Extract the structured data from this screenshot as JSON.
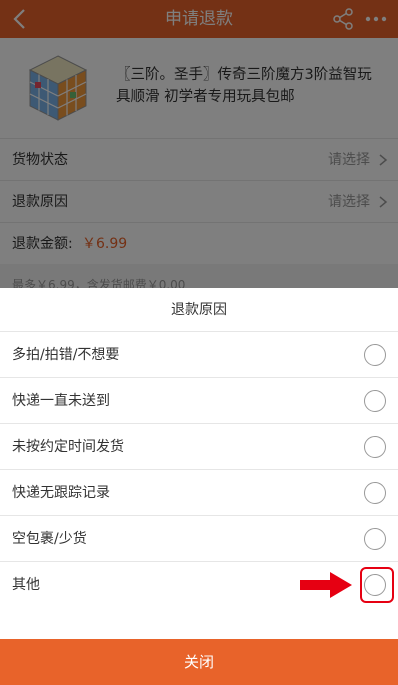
{
  "header": {
    "title": "申请退款",
    "back_icon": "chevron-left-icon",
    "share_icon": "share-icon",
    "more_icon": "more-icon"
  },
  "product": {
    "name": "〖三阶。圣手〗传奇三阶魔方3阶益智玩具顺滑 初学者专用玩具包邮"
  },
  "form": {
    "goods_status_label": "货物状态",
    "goods_status_value": "请选择",
    "reason_label": "退款原因",
    "reason_value": "请选择",
    "amount_label": "退款金额:",
    "amount_value": "￥6.99",
    "note": "最多￥6.99，含发货邮费￥0.00"
  },
  "sheet": {
    "title": "退款原因",
    "options": [
      {
        "label": "多拍/拍错/不想要"
      },
      {
        "label": "快递一直未送到"
      },
      {
        "label": "未按约定时间发货"
      },
      {
        "label": "快递无跟踪记录"
      },
      {
        "label": "空包裹/少货"
      },
      {
        "label": "其他"
      }
    ],
    "close_label": "关闭"
  },
  "colors": {
    "accent": "#e8632a",
    "highlight": "#e60012"
  }
}
